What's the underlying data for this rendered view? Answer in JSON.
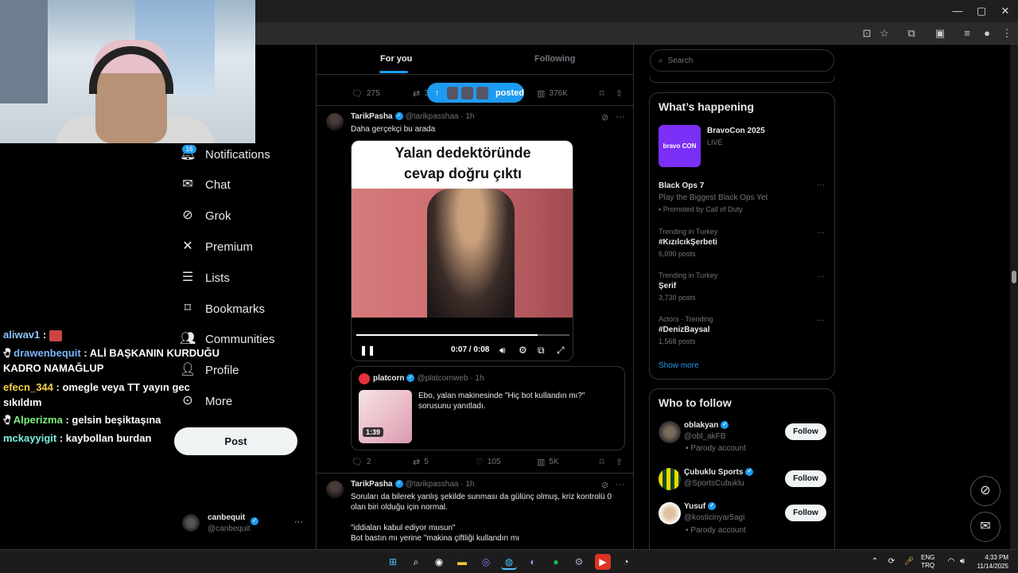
{
  "browser": {
    "minimize": "—",
    "maximize": "▢",
    "close": "✕"
  },
  "chat": [
    {
      "user": "aliwav1",
      "user_color": "#8ec5ff",
      "msg": ":"
    },
    {
      "user": "drawenbequit",
      "user_color": "#7cb6ff",
      "msg": ": ALİ BAŞKANIN KURDUĞU"
    },
    {
      "user": "",
      "user_color": "#ffffff",
      "msg": "KADRO NAMAĞLUP"
    },
    {
      "user": "efecn_344",
      "user_color": "#f7d24a",
      "msg": ": omegle veya TT yayın gec"
    },
    {
      "user": "",
      "user_color": "#ffffff",
      "msg": "sıkıldım"
    },
    {
      "user": "Alperizma",
      "user_color": "#7cf07c",
      "msg": ": gelsin beşiktaşına"
    },
    {
      "user": "mckayyigit",
      "user_color": "#7cf0e0",
      "msg": ": kaybollan burdan"
    }
  ],
  "nav": {
    "notifications_badge": "16",
    "items": [
      "Notifications",
      "Chat",
      "Grok",
      "Premium",
      "Lists",
      "Bookmarks",
      "Communities",
      "Profile",
      "More"
    ],
    "post_label": "Post"
  },
  "account": {
    "name": "canbequit",
    "handle": "@canbequit",
    "more": "···"
  },
  "main": {
    "tabs": [
      "For you",
      "Following"
    ],
    "posted_pill": "posted",
    "prev_actions": {
      "replies": "275",
      "reposts": "3",
      "views": "376K"
    },
    "post1": {
      "name": "TarikPasha",
      "handle": "@tarikpasshaa",
      "time": "· 1h",
      "text": "Daha gerçekçi bu arada",
      "video_caption": "Yalan dedektöründe cevap doğru çıktı",
      "video_time": "0:07 / 0:08",
      "progress": 0.85,
      "quote": {
        "name": "platcorn",
        "handle": "@platcornweb",
        "time": "· 1h",
        "text": "Ebo, yalan makinesinde \"Hiç bot kullandın mı?\" sorusunu yanıtladı.",
        "duration": "1:39"
      },
      "actions": {
        "replies": "2",
        "reposts": "5",
        "likes": "105",
        "views": "5K"
      }
    },
    "post2": {
      "name": "TarikPasha",
      "handle": "@tarikpasshaa",
      "time": "· 1h",
      "line1": "Soruları da bilerek yanlış şekilde sunması da gülünç olmuş, kriz kontrolü 0",
      "line2": "olan biri olduğu için normal.",
      "line3": "\"iddiaları kabul ediyor musun\"",
      "line4": "Bot bastın mı yerine \"makina çiftliği kullandın mı"
    }
  },
  "sidebar": {
    "search_placeholder": "Search",
    "happening_title": "What’s happening",
    "event": {
      "name": "BravoCon 2025",
      "status": "LIVE",
      "logo": "bravo CON"
    },
    "trends": [
      {
        "meta": "",
        "name": "Black Ops 7",
        "desc": "Play the Biggest Black Ops Yet",
        "sub": "Promoted by Call of Duty"
      },
      {
        "meta": "Trending in Turkey",
        "name": "#KızılcıkŞerbeti",
        "desc": "",
        "sub": "6,090 posts"
      },
      {
        "meta": "Trending in Turkey",
        "name": "Şerif",
        "desc": "",
        "sub": "3,730 posts"
      },
      {
        "meta": "Actors · Trending",
        "name": "#DenizBaysal",
        "desc": "",
        "sub": "1,568 posts"
      }
    ],
    "show_more": "Show more",
    "wtf_title": "Who to follow",
    "follow": [
      {
        "name": "oblakyan",
        "handle": "@obl_akFB",
        "badge": "Parody account",
        "btn": "Follow"
      },
      {
        "name": "Çubuklu Sports",
        "handle": "@SportsCubuklu",
        "badge": "",
        "btn": "Follow"
      },
      {
        "name": "Yusuf",
        "handle": "@kosticinyar5agi",
        "badge": "Parody account",
        "btn": "Follow"
      }
    ]
  },
  "taskbar": {
    "lang1": "ENG",
    "lang2": "TRQ",
    "time": "4:33 PM",
    "date": "11/14/2025"
  }
}
